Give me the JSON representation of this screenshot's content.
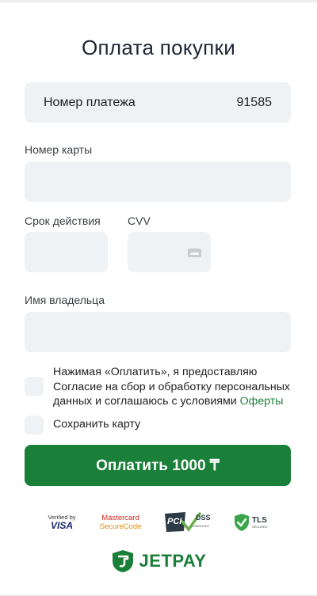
{
  "page": {
    "title": "Оплата покупки"
  },
  "payment": {
    "label": "Номер платежа",
    "value": "91585"
  },
  "card_number": {
    "label": "Номер карты",
    "value": ""
  },
  "expiry": {
    "label": "Срок действия",
    "value": ""
  },
  "cvv": {
    "label": "CVV",
    "value": ""
  },
  "holder": {
    "label": "Имя владельца",
    "value": ""
  },
  "consent": {
    "text": "Нажимая «Оплатить», я предоставляю Согласие на сбор и обработку персональных данных и соглашаюсь с условиями",
    "link": "Оферты",
    "checked": false
  },
  "save_card": {
    "label": "Сохранить карту",
    "checked": false
  },
  "pay_button": {
    "label": "Оплатить 1000 ₸"
  },
  "badges": {
    "visa_top": "Verified by",
    "visa_main": "VISA",
    "mc_top": "Mastercard",
    "mc_main": "SecureCode",
    "pci_main": "PCI",
    "pci_dss": "DSS",
    "pci_sub": "COMPLIANT",
    "tls_main": "TLS",
    "tls_sub": "SECURED"
  },
  "brand": {
    "name": "JETPAY",
    "color": "#1a7f38"
  },
  "colors": {
    "accent": "#1a7f38",
    "field_bg": "#eef2f4",
    "link": "#1c7f3c"
  }
}
